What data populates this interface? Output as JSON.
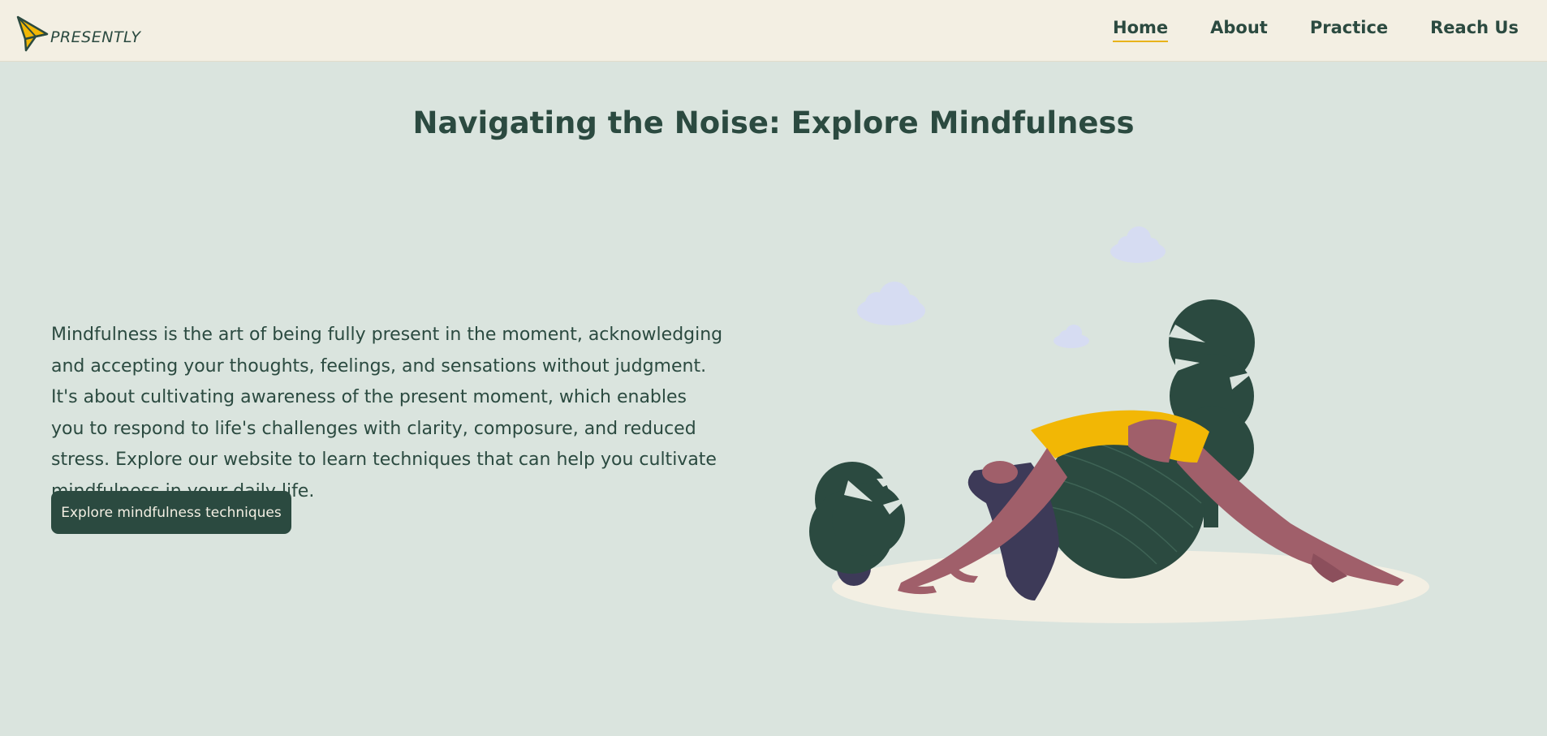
{
  "brand": {
    "name": "PRESENTLY",
    "logo_icon": "bird-icon",
    "logo_colors": {
      "fill": "#f2b705",
      "outline": "#2b4a40"
    }
  },
  "nav": {
    "items": [
      {
        "label": "Home",
        "active": true
      },
      {
        "label": "About",
        "active": false
      },
      {
        "label": "Practice",
        "active": false
      },
      {
        "label": "Reach Us",
        "active": false
      }
    ]
  },
  "hero": {
    "title": "Navigating the Noise: Explore Mindfulness",
    "body": "Mindfulness is the art of being fully present in the moment, acknowledging and accepting your thoughts, feelings, and sensations without judgment. It's about cultivating awareness of the present moment, which enables you to respond to life's challenges with clarity, composure, and reduced stress. Explore our website to learn techniques that can help you cultivate mindfulness in your daily life.",
    "cta_label": "Explore mindfulness techniques",
    "illustration": "yoga-pose-illustration"
  },
  "colors": {
    "background": "#dae4de",
    "navbar": "#f3efe3",
    "primary": "#2b4a40",
    "accent": "#f2b705",
    "skin": "#a05f6a",
    "hair": "#3d3a58",
    "cloud": "#d6dcf2"
  }
}
